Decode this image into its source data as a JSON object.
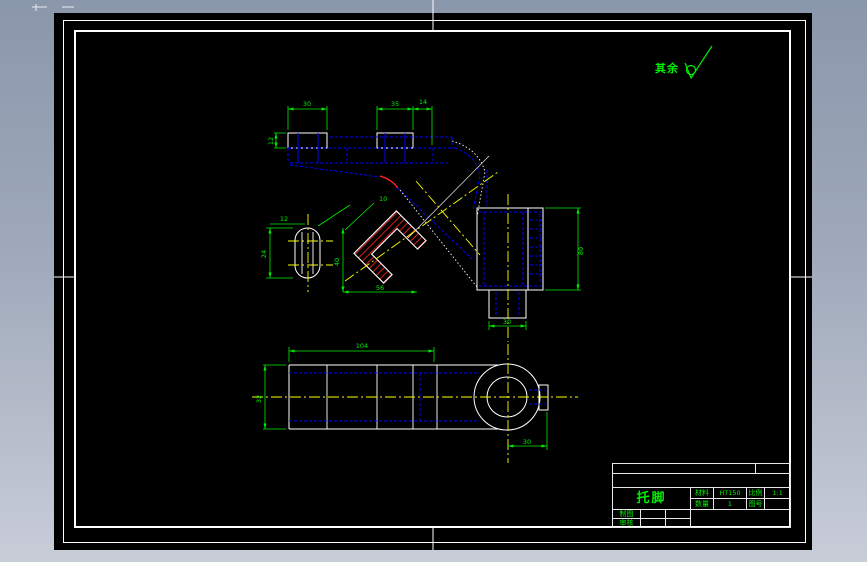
{
  "colors": {
    "desktop_top": "#8a97ab",
    "desktop_bottom": "#c8cdd8",
    "paper": "#000000",
    "hidden_line": "#0000ff",
    "dimension": "#00ee00",
    "centerline": "#ffff00",
    "hatch": "#ff0000",
    "edge": "#ffffff"
  },
  "annotations": {
    "surface_note": "其余"
  },
  "dims": {
    "pad1_width": "30",
    "pad2_width": "35",
    "pad3_width": "14",
    "pad_height": "12",
    "boss_height": "80",
    "boss_neck": "30",
    "arm_length": "104",
    "arm_width": "32",
    "eye_offset": "30",
    "slot_height": "24",
    "slot_width": "12",
    "section_depth": "40",
    "section_width": "56",
    "section_thickness": "10"
  },
  "title_block": {
    "part_name": "托脚",
    "material_label": "材料",
    "material_value": "HT150",
    "quantity_label": "数量",
    "quantity_value": "1",
    "scale_label": "比例",
    "scale_value": "1:1",
    "drawing_no_label": "图号",
    "drawing_no_value": "",
    "drafter_label": "制图",
    "checker_label": "审核"
  }
}
